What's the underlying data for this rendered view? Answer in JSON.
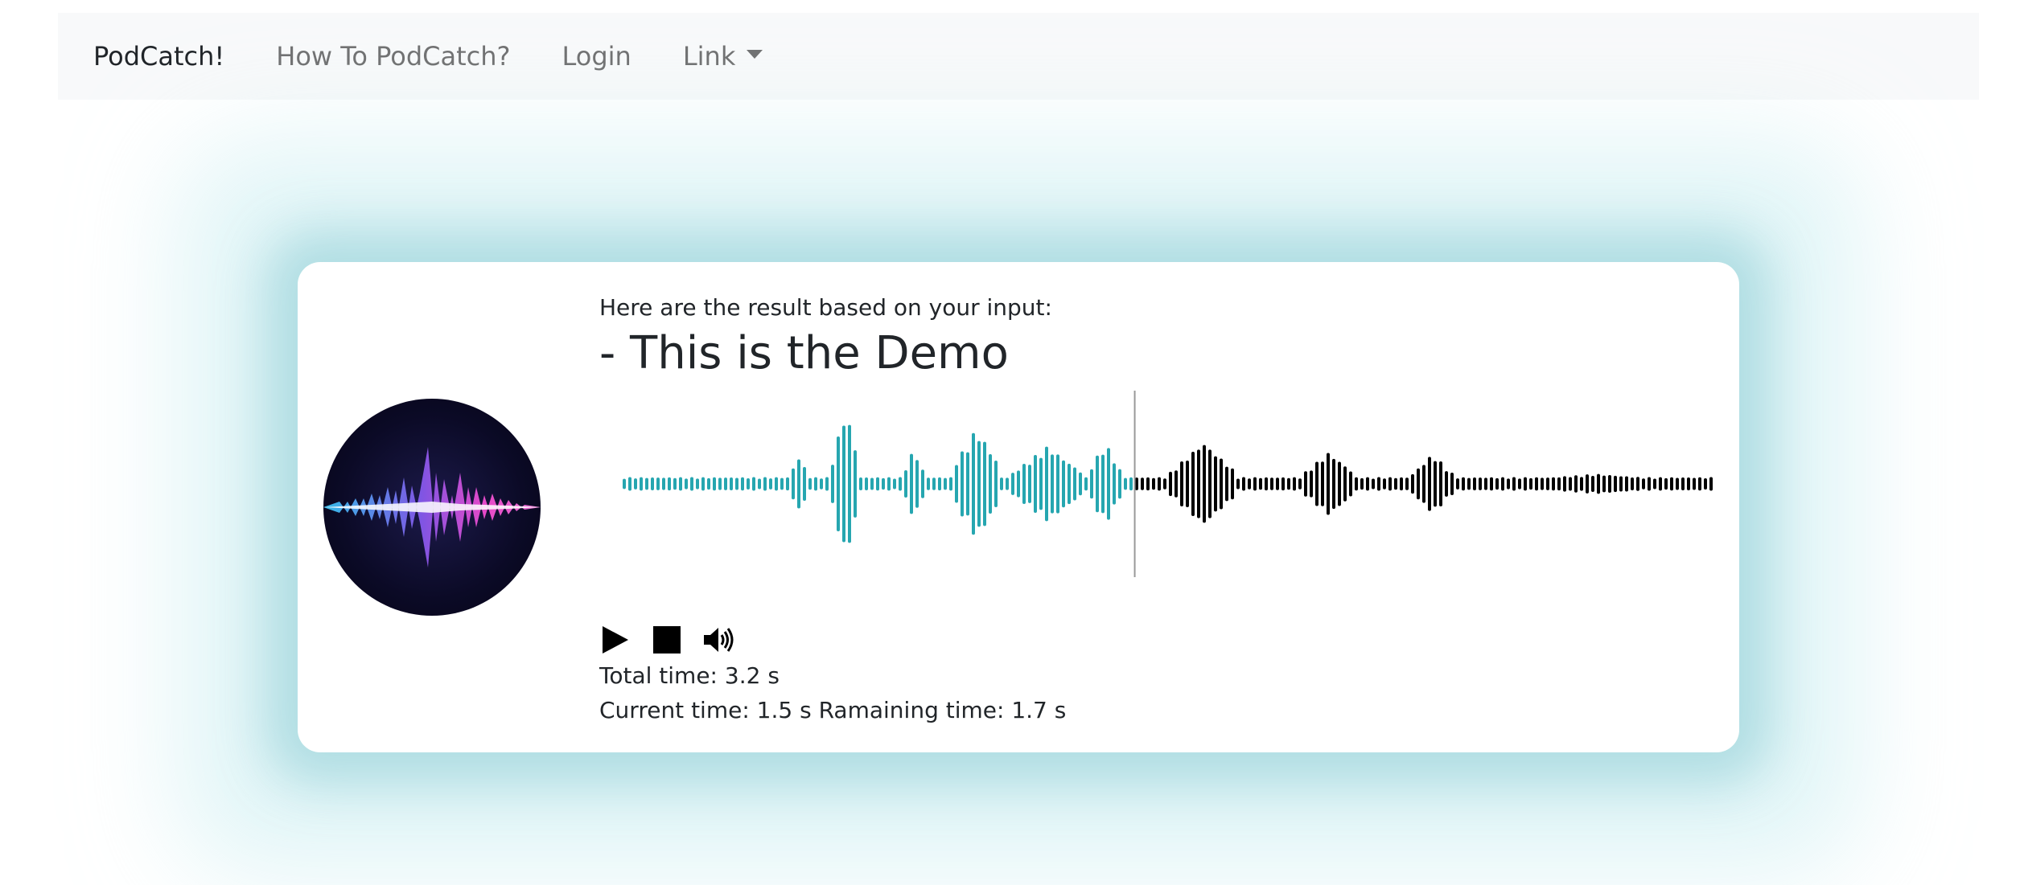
{
  "navbar": {
    "brand": "PodCatch!",
    "links": [
      "How To PodCatch?",
      "Login",
      "Link"
    ]
  },
  "result": {
    "subtitle": "Here are the result based on your input:",
    "title": "- This is the Demo"
  },
  "player": {
    "total_time_label": "Total time: 3.2 s",
    "current_time_label": "Current time: 1.5 s",
    "remaining_time_label": "Ramaining time: 1.7 s",
    "progress_fraction": 0.46875,
    "played_color": "#26a6b0",
    "unplayed_color": "#000000",
    "icons": [
      "play-icon",
      "stop-icon",
      "volume-icon"
    ]
  }
}
